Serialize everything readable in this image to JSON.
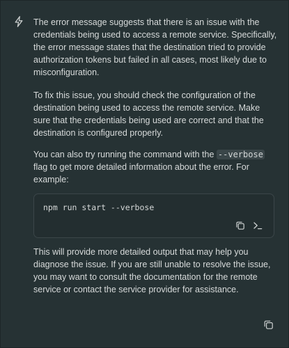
{
  "message": {
    "paragraph1": "The error message suggests that there is an issue with the credentials being used to access a remote service. Specifically, the error message states that the destination tried to provide authorization tokens but failed in all cases, most likely due to misconfiguration.",
    "paragraph2": "To fix this issue, you should check the configuration of the destination being used to access the remote service. Make sure that the credentials being used are correct and that the destination is configured properly.",
    "paragraph3_before": "You can also try running the command with the ",
    "paragraph3_code": "--verbose",
    "paragraph3_after": " flag to get more detailed information about the error. For example:",
    "code_block": "npm run start --verbose",
    "paragraph4": "This will provide more detailed output that may help you diagnose the issue. If you are still unable to resolve the issue, you may want to consult the documentation for the remote service or contact the service provider for assistance."
  },
  "icons": {
    "assistant": "lightning-bolt-icon",
    "code_copy": "copy-icon",
    "code_run": "terminal-icon",
    "message_copy": "copy-icon"
  },
  "colors": {
    "background": "#263234",
    "text": "#d7dada",
    "code_background": "#232e30",
    "inline_code_background": "#3a4649"
  }
}
